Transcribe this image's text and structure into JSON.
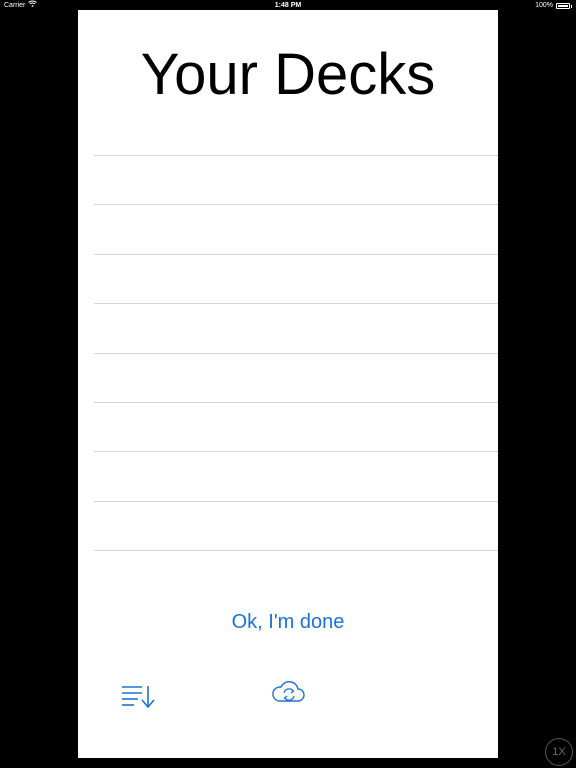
{
  "status_bar": {
    "carrier": "Carrier",
    "time": "1:48 PM",
    "battery": "100%",
    "battery_level": 1.0
  },
  "page": {
    "title": "Your Decks"
  },
  "deck_list": {
    "rows": [
      "",
      "",
      "",
      "",
      "",
      "",
      "",
      "",
      ""
    ]
  },
  "actions": {
    "done_label": "Ok, I'm done",
    "sort_icon": "sort-descending-icon",
    "sync_icon": "cloud-sync-icon"
  },
  "overlay": {
    "scale_label": "1X"
  },
  "colors": {
    "accent": "#1a73d9",
    "background": "#000000",
    "panel": "#ffffff",
    "separator": "#d6d6d6"
  }
}
